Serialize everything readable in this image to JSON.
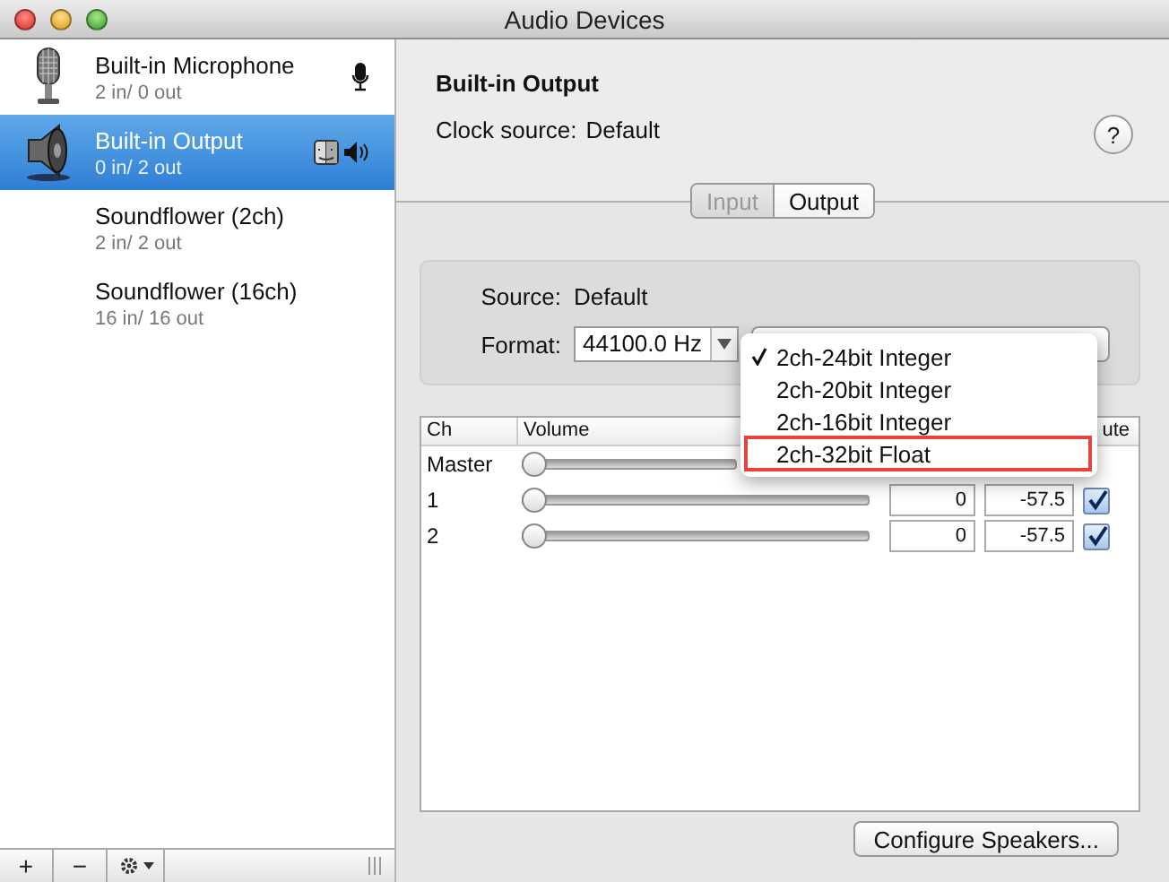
{
  "window": {
    "title": "Audio Devices"
  },
  "devices": [
    {
      "kind": "microphone",
      "name": "Built-in Microphone",
      "io": "2 in/ 0 out",
      "selected": false
    },
    {
      "kind": "speaker",
      "name": "Built-in Output",
      "io": "0 in/ 2 out",
      "selected": true
    },
    {
      "kind": "virtual",
      "name": "Soundflower (2ch)",
      "io": "2 in/ 2 out",
      "selected": false
    },
    {
      "kind": "virtual",
      "name": "Soundflower (16ch)",
      "io": "16 in/ 16 out",
      "selected": false
    }
  ],
  "sidebar_toolbar": {
    "add": "+",
    "remove": "−"
  },
  "detail": {
    "title": "Built-in Output",
    "clock_label": "Clock source:",
    "clock_value": "Default",
    "help": "?"
  },
  "tabs": [
    {
      "label": "Input",
      "selected": false,
      "disabled": true
    },
    {
      "label": "Output",
      "selected": true,
      "disabled": false
    }
  ],
  "source": {
    "label": "Source:",
    "value": "Default"
  },
  "format": {
    "label": "Format:",
    "rate": "44100.0 Hz"
  },
  "format_menu": [
    {
      "label": "2ch-24bit Integer",
      "checked": true,
      "highlighted": false
    },
    {
      "label": "2ch-20bit Integer",
      "checked": false,
      "highlighted": false
    },
    {
      "label": "2ch-16bit Integer",
      "checked": false,
      "highlighted": false
    },
    {
      "label": "2ch-32bit Float",
      "checked": false,
      "highlighted": true
    }
  ],
  "table": {
    "columns": [
      "Ch",
      "Volume",
      "ute"
    ],
    "rows": [
      {
        "ch": "Master",
        "level": 0
      },
      {
        "ch": "1",
        "level": 0,
        "value": "0",
        "db": "-57.5",
        "mute": true
      },
      {
        "ch": "2",
        "level": 0,
        "value": "0",
        "db": "-57.5",
        "mute": true
      }
    ]
  },
  "configure_button": "Configure Speakers..."
}
